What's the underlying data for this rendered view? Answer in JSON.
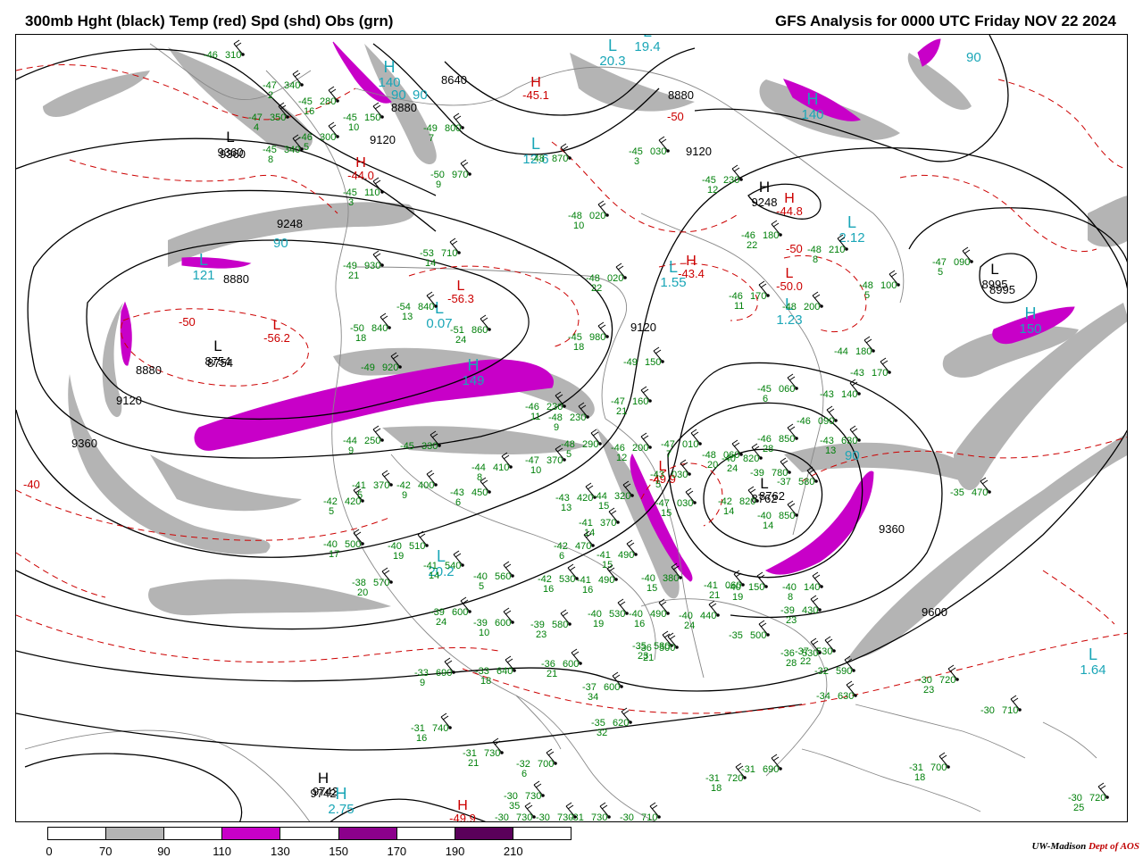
{
  "header": {
    "left_title": "300mb Hght (black) Temp (red) Spd (shd) Obs (grn)",
    "right_title": "GFS Analysis for 0000 UTC Friday  NOV 22 2024"
  },
  "colors": {
    "height_contour": "#000000",
    "temperature_contour": "#cc0000",
    "obs": "#00800a",
    "speed_center_label": "#1aa6b7",
    "shade_70_90": "#b4b4b4",
    "shade_110_130": "#c800c8",
    "shade_150_170": "#8c008c",
    "shade_190_210": "#5a005a",
    "geography": "#888888"
  },
  "colorbar": {
    "labels": [
      "0",
      "70",
      "90",
      "110",
      "130",
      "150",
      "170",
      "190",
      "210"
    ],
    "segments": [
      "#ffffff",
      "#b4b4b4",
      "#ffffff",
      "#c800c8",
      "#ffffff",
      "#8c008c",
      "#ffffff",
      "#5a005a",
      "#ffffff"
    ]
  },
  "credit": {
    "org": "UW-Madison",
    "dept": "Dept of AOS"
  },
  "height_labels": [
    "8640",
    "8880",
    "9120",
    "9360",
    "8880",
    "9120",
    "9248",
    "8995",
    "9120",
    "8880",
    "8754",
    "9120",
    "9360",
    "8762",
    "9360",
    "9600",
    "9742",
    "8880"
  ],
  "height_centers": [
    {
      "type": "H",
      "value": "9248"
    },
    {
      "type": "H",
      "value": "9742"
    },
    {
      "type": "L",
      "value": "8754"
    },
    {
      "type": "L",
      "value": "8995"
    },
    {
      "type": "L",
      "value": "8762"
    },
    {
      "type": "L",
      "value": "9360"
    }
  ],
  "temp_centers": [
    {
      "type": "H",
      "value": "-44.0"
    },
    {
      "type": "H",
      "value": "-43.4"
    },
    {
      "type": "H",
      "value": "-44.8"
    },
    {
      "type": "H",
      "value": "-49.9"
    },
    {
      "type": "H",
      "value": "-45.1"
    },
    {
      "type": "L",
      "value": "-56.3"
    },
    {
      "type": "L",
      "value": "-56.2"
    },
    {
      "type": "L",
      "value": "-50.0"
    },
    {
      "type": "L",
      "value": "-49.9"
    }
  ],
  "temp_labels": [
    "-50",
    "-50",
    "-40",
    "-50"
  ],
  "speed_centers": [
    {
      "type": "H",
      "value": "149"
    },
    {
      "type": "H",
      "value": "140"
    },
    {
      "type": "H",
      "value": "140"
    },
    {
      "type": "H",
      "value": "150"
    },
    {
      "type": "L",
      "value": "1.55"
    },
    {
      "type": "L",
      "value": "1.23"
    },
    {
      "type": "L",
      "value": "2.12"
    },
    {
      "type": "L",
      "value": "0.07"
    },
    {
      "type": "L",
      "value": "20.2"
    },
    {
      "type": "H",
      "value": "2.75"
    },
    {
      "type": "L",
      "value": "1.64"
    },
    {
      "type": "L",
      "value": "121"
    },
    {
      "type": "L",
      "value": "19.4"
    },
    {
      "type": "L",
      "value": "20.3"
    },
    {
      "type": "L",
      "value": "12.6"
    }
  ],
  "speed_labels": [
    "90",
    "90",
    "90",
    "90",
    "90"
  ],
  "observations": [
    {
      "t": "-46",
      "z": "310",
      "d": ""
    },
    {
      "t": "-47",
      "z": "340",
      "d": "2"
    },
    {
      "t": "-47",
      "z": "350",
      "d": "4"
    },
    {
      "t": "-45",
      "z": "280",
      "d": "16"
    },
    {
      "t": "-46",
      "z": "300",
      "d": "5"
    },
    {
      "t": "-45",
      "z": "340",
      "d": "8"
    },
    {
      "t": "-45",
      "z": "150",
      "d": "10"
    },
    {
      "t": "-49",
      "z": "800",
      "d": "7"
    },
    {
      "t": "-45",
      "z": "110",
      "d": "3"
    },
    {
      "t": "-50",
      "z": "970",
      "d": "9"
    },
    {
      "t": "-48",
      "z": "870",
      "d": ""
    },
    {
      "t": "-45",
      "z": "030",
      "d": "3"
    },
    {
      "t": "-45",
      "z": "230",
      "d": "12"
    },
    {
      "t": "-48",
      "z": "020",
      "d": "10"
    },
    {
      "t": "-46",
      "z": "180",
      "d": "22"
    },
    {
      "t": "-48",
      "z": "210",
      "d": "8"
    },
    {
      "t": "-47",
      "z": "090",
      "d": "5"
    },
    {
      "t": "-48",
      "z": "100",
      "d": "5"
    },
    {
      "t": "-53",
      "z": "710",
      "d": "14"
    },
    {
      "t": "-49",
      "z": "930",
      "d": "21"
    },
    {
      "t": "-48",
      "z": "020",
      "d": "22"
    },
    {
      "t": "-46",
      "z": "170",
      "d": "11"
    },
    {
      "t": "-48",
      "z": "200",
      "d": ""
    },
    {
      "t": "-54",
      "z": "840",
      "d": "13"
    },
    {
      "t": "-50",
      "z": "840",
      "d": "18"
    },
    {
      "t": "-51",
      "z": "860",
      "d": "24"
    },
    {
      "t": "-45",
      "z": "980",
      "d": "18"
    },
    {
      "t": "-49",
      "z": "150",
      "d": ""
    },
    {
      "t": "-44",
      "z": "180",
      "d": ""
    },
    {
      "t": "-43",
      "z": "170",
      "d": ""
    },
    {
      "t": "-49",
      "z": "920",
      "d": ""
    },
    {
      "t": "-45",
      "z": "060",
      "d": "6"
    },
    {
      "t": "-43",
      "z": "140",
      "d": ""
    },
    {
      "t": "-47",
      "z": "160",
      "d": "21"
    },
    {
      "t": "-46",
      "z": "090",
      "d": ""
    },
    {
      "t": "-46",
      "z": "230",
      "d": "11"
    },
    {
      "t": "-48",
      "z": "230",
      "d": "9"
    },
    {
      "t": "-48",
      "z": "290",
      "d": "5"
    },
    {
      "t": "-46",
      "z": "200",
      "d": "12"
    },
    {
      "t": "-47",
      "z": "010",
      "d": "7"
    },
    {
      "t": "-48",
      "z": "060",
      "d": "20"
    },
    {
      "t": "-40",
      "z": "820",
      "d": "24"
    },
    {
      "t": "-46",
      "z": "850",
      "d": "28"
    },
    {
      "t": "-43",
      "z": "630",
      "d": "13"
    },
    {
      "t": "-44",
      "z": "250",
      "d": "9"
    },
    {
      "t": "-45",
      "z": "330",
      "d": ""
    },
    {
      "t": "-47",
      "z": "370",
      "d": "10"
    },
    {
      "t": "-44",
      "z": "410",
      "d": "8"
    },
    {
      "t": "-39",
      "z": "780",
      "d": ""
    },
    {
      "t": "-37",
      "z": "580",
      "d": ""
    },
    {
      "t": "-43",
      "z": "030",
      "d": "5"
    },
    {
      "t": "-41",
      "z": "370",
      "d": "5"
    },
    {
      "t": "-42",
      "z": "400",
      "d": "9"
    },
    {
      "t": "-42",
      "z": "420",
      "d": "5"
    },
    {
      "t": "-43",
      "z": "450",
      "d": "6"
    },
    {
      "t": "-43",
      "z": "420",
      "d": "13"
    },
    {
      "t": "-44",
      "z": "320",
      "d": "15"
    },
    {
      "t": "-47",
      "z": "030",
      "d": "15"
    },
    {
      "t": "-42",
      "z": "820",
      "d": "14"
    },
    {
      "t": "-40",
      "z": "850",
      "d": "14"
    },
    {
      "t": "-41",
      "z": "490",
      "d": "15"
    },
    {
      "t": "-41",
      "z": "370",
      "d": "14"
    },
    {
      "t": "-35",
      "z": "470",
      "d": ""
    },
    {
      "t": "-40",
      "z": "500",
      "d": "17"
    },
    {
      "t": "-40",
      "z": "510",
      "d": "19"
    },
    {
      "t": "-41",
      "z": "540",
      "d": "14"
    },
    {
      "t": "-42",
      "z": "470",
      "d": "6"
    },
    {
      "t": "-42",
      "z": "530",
      "d": "16"
    },
    {
      "t": "-40",
      "z": "560",
      "d": "5"
    },
    {
      "t": "-41",
      "z": "490",
      "d": "16"
    },
    {
      "t": "-40",
      "z": "380",
      "d": "15"
    },
    {
      "t": "-41",
      "z": "060",
      "d": "21"
    },
    {
      "t": "-40",
      "z": "150",
      "d": "19"
    },
    {
      "t": "-40",
      "z": "140",
      "d": "8"
    },
    {
      "t": "-38",
      "z": "570",
      "d": "20"
    },
    {
      "t": "-39",
      "z": "600",
      "d": "24"
    },
    {
      "t": "-39",
      "z": "600",
      "d": "10"
    },
    {
      "t": "-39",
      "z": "580",
      "d": "23"
    },
    {
      "t": "-40",
      "z": "530",
      "d": "19"
    },
    {
      "t": "-40",
      "z": "490",
      "d": "16"
    },
    {
      "t": "-40",
      "z": "440",
      "d": "24"
    },
    {
      "t": "-39",
      "z": "430",
      "d": "23"
    },
    {
      "t": "-37",
      "z": "530",
      "d": "22"
    },
    {
      "t": "-35",
      "z": "530",
      "d": "23"
    },
    {
      "t": "-35",
      "z": "500",
      "d": ""
    },
    {
      "t": "-36",
      "z": "500",
      "d": "21"
    },
    {
      "t": "-33",
      "z": "690",
      "d": "9"
    },
    {
      "t": "-33",
      "z": "640",
      "d": "18"
    },
    {
      "t": "-36",
      "z": "600",
      "d": "21"
    },
    {
      "t": "-37",
      "z": "600",
      "d": "34"
    },
    {
      "t": "-35",
      "z": "620",
      "d": "32"
    },
    {
      "t": "-36",
      "z": "530",
      "d": "28"
    },
    {
      "t": "-32",
      "z": "590",
      "d": ""
    },
    {
      "t": "-34",
      "z": "630",
      "d": ""
    },
    {
      "t": "-30",
      "z": "720",
      "d": "23"
    },
    {
      "t": "-30",
      "z": "710",
      "d": ""
    },
    {
      "t": "-31",
      "z": "740",
      "d": "16"
    },
    {
      "t": "-31",
      "z": "730",
      "d": "21"
    },
    {
      "t": "-32",
      "z": "700",
      "d": "6"
    },
    {
      "t": "-30",
      "z": "730",
      "d": "35"
    },
    {
      "t": "-31",
      "z": "720",
      "d": "18"
    },
    {
      "t": "-31",
      "z": "690",
      "d": ""
    },
    {
      "t": "-31",
      "z": "700",
      "d": "18"
    },
    {
      "t": "-30",
      "z": "720",
      "d": "25"
    },
    {
      "t": "-31",
      "z": "730",
      "d": ""
    },
    {
      "t": "-30",
      "z": "710",
      "d": ""
    },
    {
      "t": "-30",
      "z": "730",
      "d": ""
    },
    {
      "t": "-30",
      "z": "730",
      "d": ""
    }
  ]
}
